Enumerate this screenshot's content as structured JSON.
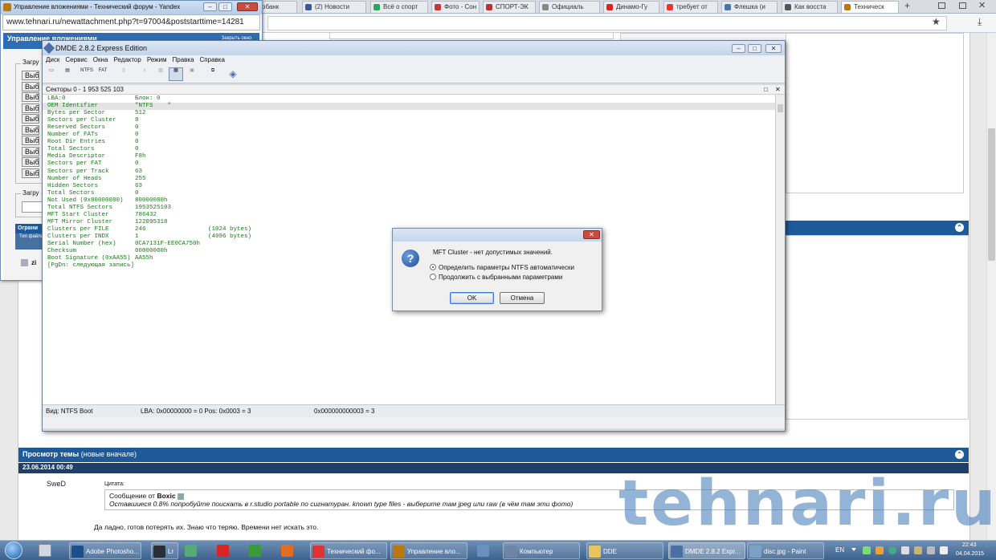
{
  "browser": {
    "tabs": [
      {
        "label": "обанк",
        "color": "#d25"
      },
      {
        "label": "(2) Новости",
        "color": "#3b5998"
      },
      {
        "label": "Всё о спорт",
        "color": "#2a5"
      },
      {
        "label": "Фото - Сон",
        "color": "#c33"
      },
      {
        "label": "СПОРТ-ЭК",
        "color": "#b33"
      },
      {
        "label": "Официаль",
        "color": "#888"
      },
      {
        "label": "Динамо-Гу",
        "color": "#d22"
      },
      {
        "label": "требует от",
        "color": "#e33"
      },
      {
        "label": "Флешка (и",
        "color": "#47a"
      },
      {
        "label": "Как восста",
        "color": "#555"
      },
      {
        "label": "Техническ",
        "color": "#b71"
      }
    ],
    "new_tab": "+",
    "star": "★",
    "download": "⤓"
  },
  "win2": {
    "title": "Управление вложениями - Технический форум - Yandex",
    "url": "www.tehnari.ru/newattachment.php?t=97004&poststarttime=14281",
    "header": "Управление вложениями",
    "header_right": "Закрыть окно",
    "group1": "Загру",
    "buttons": [
      "Выб",
      "Выб",
      "Выб",
      "Выб",
      "Выб",
      "Выб",
      "Выб",
      "Выб",
      "Выб",
      "Выб"
    ],
    "group2": "Загру",
    "restrict": "Ограни",
    "col1": "Тип файла",
    "row_label": "zi"
  },
  "forum": {
    "view_title": "Просмотр темы",
    "view_subtitle": "(новые вначале)",
    "post_date": "23.06.2014 00:49",
    "user": "SweD",
    "quote_label": "Цитата:",
    "quote_author_prefix": "Сообщение от",
    "quote_author": "Boxic",
    "quote_text": "Оставшиеся 0.8% попробуйте поискать в r.studio portable по сигнатуран. known type files - выберите там jpeg или raw (в чём там эти фото)",
    "reply": "Да ладно, готов потерять их. Знаю что теряю. Времени нет искать это.",
    "watermark": "tehnari.ru"
  },
  "dmde": {
    "title": "DMDE 2.8.2 Express Edition",
    "menu": [
      "Диск",
      "Сервис",
      "Окна",
      "Редактор",
      "Режим",
      "Правка",
      "Справка"
    ],
    "toolbar_ntfs": "NTFS",
    "toolbar_fat": "FAT",
    "sectors": "Секторы 0 - 1 953 525 103",
    "rows": [
      {
        "k": "LBA:0",
        "v": "Блок: 0",
        "e": ""
      },
      {
        "k": "OEM Identifier",
        "v": "\"NTFS    \"",
        "e": ""
      },
      {
        "k": "Bytes per Sector",
        "v": "512",
        "e": ""
      },
      {
        "k": "Sectors per Cluster",
        "v": "8",
        "e": ""
      },
      {
        "k": "Reserved Sectors",
        "v": "0",
        "e": ""
      },
      {
        "k": "Number of FATs",
        "v": "0",
        "e": ""
      },
      {
        "k": "Root Dir Entries",
        "v": "0",
        "e": ""
      },
      {
        "k": "Total Sectors",
        "v": "0",
        "e": ""
      },
      {
        "k": "Media Descriptor",
        "v": "F8h",
        "e": ""
      },
      {
        "k": "Sectors per FAT",
        "v": "0",
        "e": ""
      },
      {
        "k": "Sectors per Track",
        "v": "63",
        "e": ""
      },
      {
        "k": "Number of Heads",
        "v": "255",
        "e": ""
      },
      {
        "k": "Hidden Sectors",
        "v": "63",
        "e": ""
      },
      {
        "k": "Total Sectors",
        "v": "0",
        "e": ""
      },
      {
        "k": "Not Used (0x80000080)",
        "v": "80000080h",
        "e": ""
      },
      {
        "k": "Total NTFS Sectors",
        "v": "1953525103",
        "e": ""
      },
      {
        "k": "MFT Start Cluster",
        "v": "786432",
        "e": ""
      },
      {
        "k": "MFT Mirror Cluster",
        "v": "122095318",
        "e": ""
      },
      {
        "k": "Clusters per FILE",
        "v": "246",
        "e": "(1024 bytes)"
      },
      {
        "k": "Clusters per INDX",
        "v": "1",
        "e": "(4096 bytes)"
      },
      {
        "k": "Serial Number (hex)",
        "v": "0CA7131F-EE0CA750h",
        "e": ""
      },
      {
        "k": "Checksum",
        "v": "00000000h",
        "e": ""
      },
      {
        "k": "Boot Signature (0xAA55)",
        "v": "AA55h",
        "e": ""
      },
      {
        "k": "[PgDn: следующая запись]",
        "v": "",
        "e": ""
      }
    ],
    "status_left": "Вид: NTFS Boot",
    "status_mid": "LBA: 0x00000000 = 0  Pos: 0x0003 = 3",
    "status_right": "0x000000000003 = 3"
  },
  "dialog": {
    "message": "MFT Cluster - нет допустимых значений.",
    "option1": "Определить параметры NTFS автоматически",
    "option2": "Продолжить с выбранными параметрами",
    "ok": "OK",
    "cancel": "Отмена"
  },
  "taskbar": {
    "items": [
      {
        "label": "Adobe Photosho...",
        "color": "#1b4f8c"
      },
      {
        "label": "Lr",
        "color": "#2a2f36"
      },
      {
        "label": "",
        "color": "#5a7"
      },
      {
        "label": "",
        "color": "#d22"
      },
      {
        "label": "",
        "color": "#3a9a3a"
      },
      {
        "label": "",
        "color": "#e56b1f"
      },
      {
        "label": "Технический фо...",
        "color": "#d33"
      },
      {
        "label": "Управление вло...",
        "color": "#b71"
      },
      {
        "label": "",
        "color": "#6b8fbf"
      },
      {
        "label": "Компьютер",
        "color": "#6d86a8"
      },
      {
        "label": "DDE",
        "color": "#e8c45c"
      },
      {
        "label": "DMDE 2.8.2 Expr...",
        "color": "#4a6fa5"
      },
      {
        "label": "disc.jpg - Paint",
        "color": "#7da0c8"
      }
    ],
    "lang": "EN",
    "time": "22:43",
    "date": "04.04.2015"
  },
  "colors": {
    "forum_header": "#1e5a9a",
    "text_green": "#177a17",
    "close_red": "#c94c3c"
  }
}
